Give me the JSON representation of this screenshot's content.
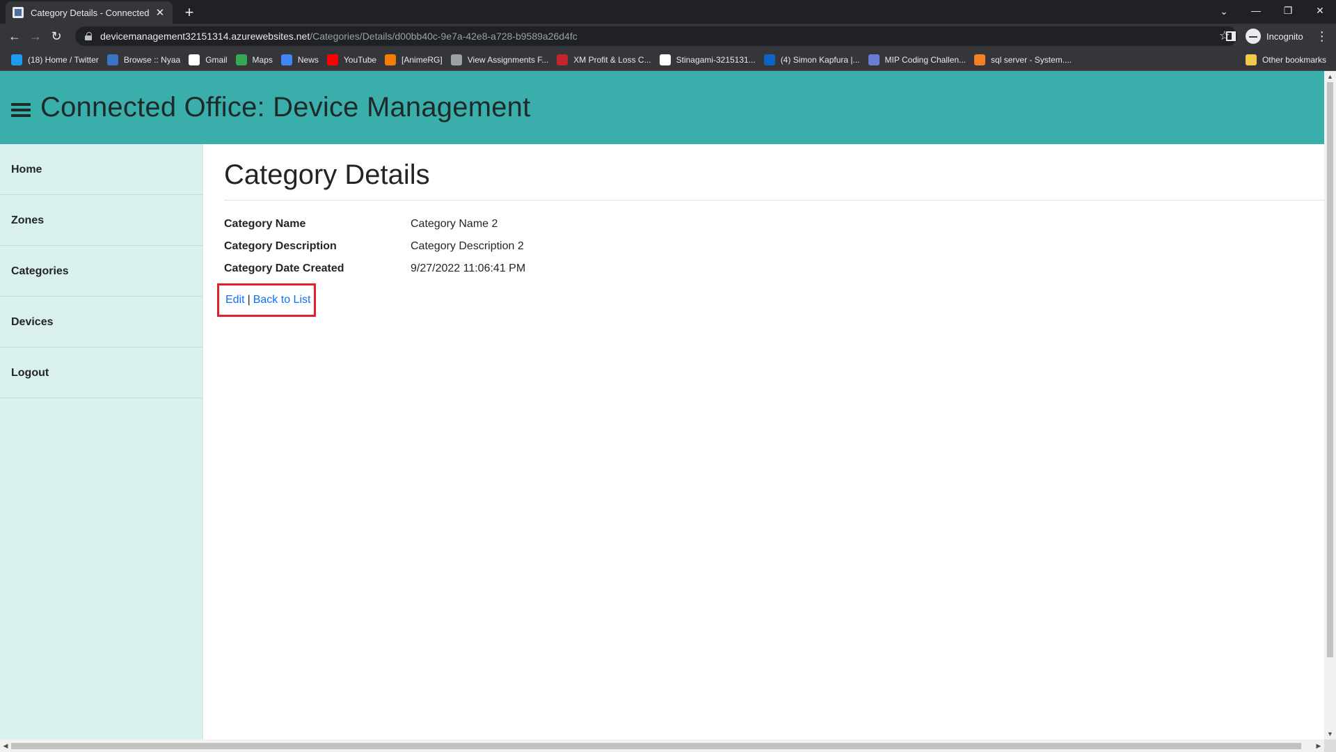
{
  "browser": {
    "tab_title": "Category Details - Connected Office",
    "tab_close": "✕",
    "new_tab": "+",
    "url_host": "devicemanagement32151314.azurewebsites.net",
    "url_path": "/Categories/Details/d00bb40c-9e7a-42e8-a728-b9589a26d4fc",
    "profile_label": "Incognito",
    "bookmarks": [
      {
        "label": "(18) Home / Twitter",
        "icon": "twitter-icon",
        "color": "#1d9bf0"
      },
      {
        "label": "Browse :: Nyaa",
        "icon": "nyaa-icon",
        "color": "#3b73c5"
      },
      {
        "label": "Gmail",
        "icon": "google-icon",
        "color": "#ffffff"
      },
      {
        "label": "Maps",
        "icon": "maps-icon",
        "color": "#34a853"
      },
      {
        "label": "News",
        "icon": "news-icon",
        "color": "#4285f4"
      },
      {
        "label": "YouTube",
        "icon": "youtube-icon",
        "color": "#ff0000"
      },
      {
        "label": "[AnimeRG]",
        "icon": "blogger-icon",
        "color": "#f57d00"
      },
      {
        "label": "View Assignments F...",
        "icon": "globe-icon",
        "color": "#9aa0a6"
      },
      {
        "label": "XM Profit & Loss C...",
        "icon": "xm-icon",
        "color": "#c1272d"
      },
      {
        "label": "Stinagami-3215131...",
        "icon": "github-icon",
        "color": "#ffffff"
      },
      {
        "label": "(4) Simon Kapfura |...",
        "icon": "linkedin-icon",
        "color": "#0a66c2"
      },
      {
        "label": "MIP Coding Challen...",
        "icon": "mip-icon",
        "color": "#6b7bd6"
      },
      {
        "label": "sql server - System....",
        "icon": "stackoverflow-icon",
        "color": "#f48024"
      }
    ],
    "other_bookmarks": "Other bookmarks"
  },
  "app": {
    "title": "Connected Office: Device Management"
  },
  "sidebar": {
    "items": [
      {
        "label": "Home"
      },
      {
        "label": "Zones"
      },
      {
        "label": "Categories"
      },
      {
        "label": "Devices"
      },
      {
        "label": "Logout"
      }
    ]
  },
  "main": {
    "page_title": "Category Details",
    "fields": [
      {
        "label": "Category Name",
        "value": "Category Name 2"
      },
      {
        "label": "Category Description",
        "value": "Category Description 2"
      },
      {
        "label": "Category Date Created",
        "value": "9/27/2022 11:06:41 PM"
      }
    ],
    "edit_link": "Edit",
    "separator": "|",
    "back_link": "Back to List"
  },
  "colors": {
    "header_bg": "#3aaeaa",
    "sidebar_bg": "#daf0ee",
    "link": "#0d6efd",
    "highlight_box": "#e0202b"
  }
}
